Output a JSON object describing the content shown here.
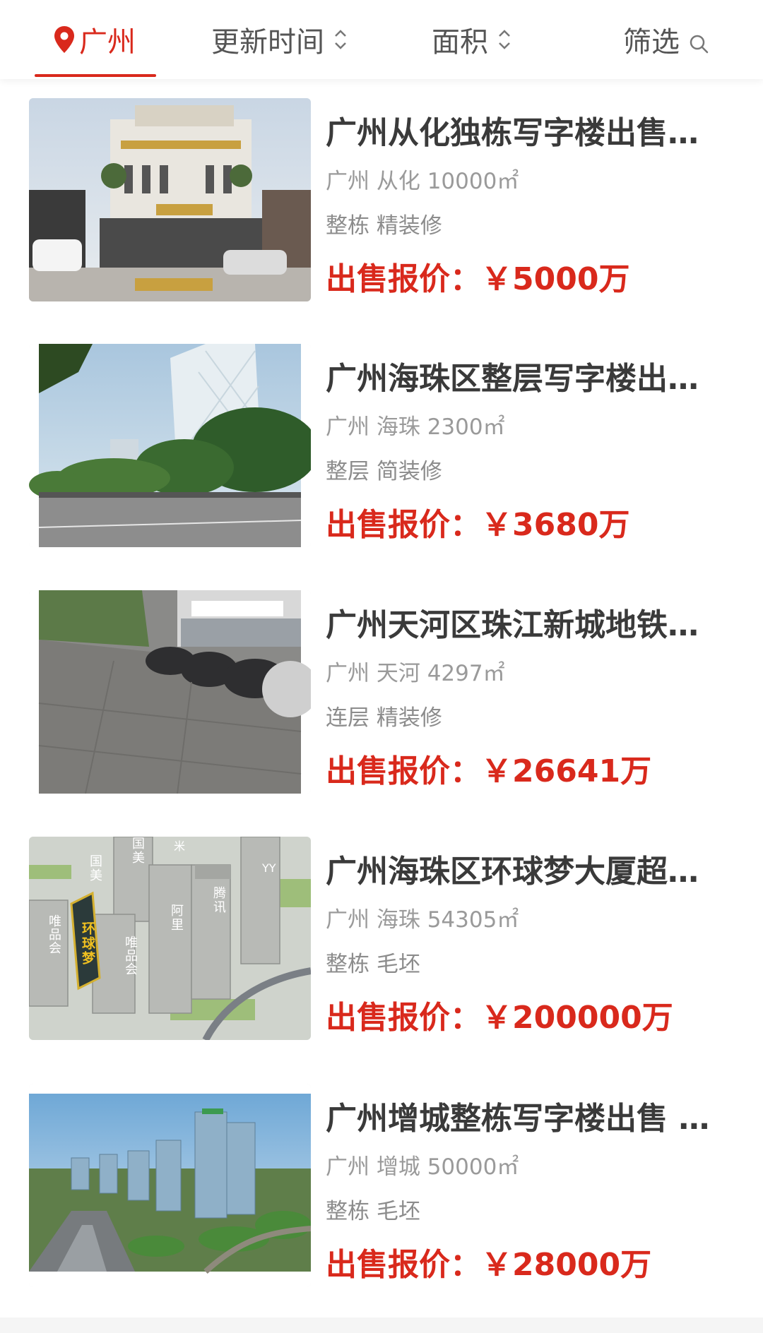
{
  "header": {
    "city_label": "广州",
    "sort_time_label": "更新时间",
    "sort_area_label": "面积",
    "filter_label": "筛选"
  },
  "listings": [
    {
      "title": "广州从化独栋写字楼出售…",
      "location": "广州 从化 10000㎡",
      "tags": "整栋 精装修",
      "price": "出售报价：￥5000万"
    },
    {
      "title": "广州海珠区整层写字楼出…",
      "location": "广州 海珠 2300㎡",
      "tags": "整层 简装修",
      "price": "出售报价：￥3680万"
    },
    {
      "title": "广州天河区珠江新城地铁…",
      "location": "广州 天河 4297㎡",
      "tags": "连层 精装修",
      "price": "出售报价：￥26641万"
    },
    {
      "title": "广州海珠区环球梦大厦超…",
      "location": "广州 海珠 54305㎡",
      "tags": "整栋 毛坯",
      "price": "出售报价：￥200000万",
      "image_labels": [
        "国美",
        "米",
        "YY",
        "腾讯",
        "阿里",
        "唯品会",
        "环球梦",
        "国美",
        "唯品会"
      ]
    },
    {
      "title": "广州增城整栋写字楼出售 …",
      "location": "广州 增城 50000㎡",
      "tags": "整栋 毛坯",
      "price": "出售报价：￥28000万"
    }
  ],
  "colors": {
    "accent": "#d9291c",
    "title_text": "#3a3a3a",
    "meta_text": "#9a9a9a"
  }
}
